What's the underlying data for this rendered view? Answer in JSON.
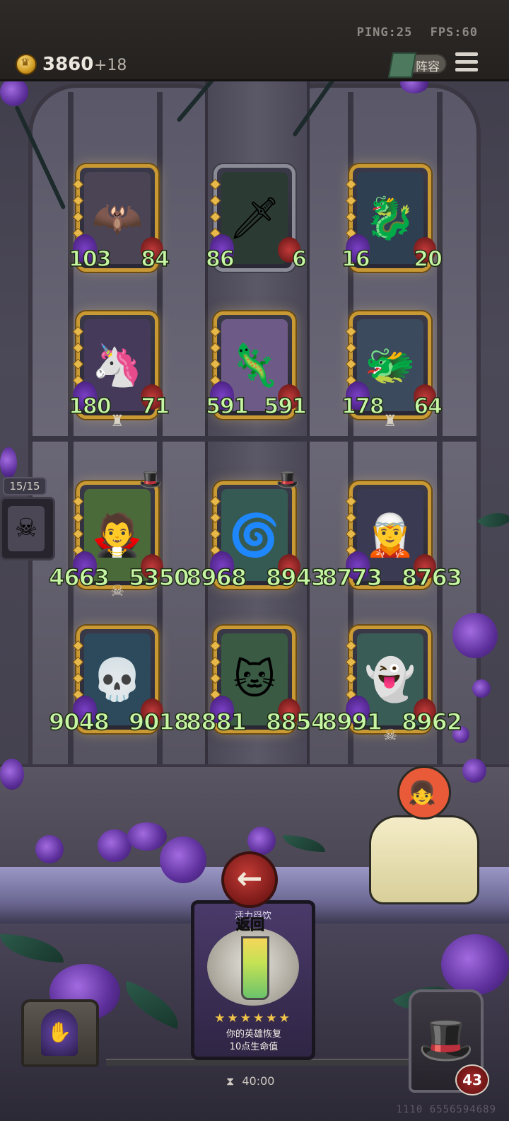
{
  "network": {
    "ping": "PING:25",
    "fps": "FPS:60"
  },
  "gold": {
    "amount": "3860",
    "delta": "+18"
  },
  "lineup_button": {
    "label": "阵容"
  },
  "bench": {
    "count": "15/15",
    "face": "☠"
  },
  "heroes": [
    {
      "atk": "103",
      "hp": "84",
      "art": "🦇",
      "bg": "#4a4454",
      "silver": false,
      "tribe": "",
      "hat": false
    },
    {
      "atk": "86",
      "hp": "6",
      "art": "🗡",
      "bg": "#2c3a34",
      "silver": true,
      "tribe": "",
      "hat": false
    },
    {
      "atk": "16",
      "hp": "20",
      "art": "🐉",
      "bg": "#2e3f52",
      "silver": false,
      "tribe": "",
      "hat": false
    },
    {
      "atk": "180",
      "hp": "71",
      "art": "🦄",
      "bg": "#463a5a",
      "silver": false,
      "tribe": "♜",
      "hat": false
    },
    {
      "atk": "591",
      "hp": "591",
      "art": "🦎",
      "bg": "#6e5a86",
      "silver": false,
      "tribe": "",
      "hat": false
    },
    {
      "atk": "178",
      "hp": "64",
      "art": "🐲",
      "bg": "#3b4a5c",
      "silver": false,
      "tribe": "♜",
      "hat": false
    },
    {
      "atk": "4663",
      "hp": "5350",
      "art": "🧛",
      "bg": "#4a6a3a",
      "silver": false,
      "tribe": "☠",
      "hat": true
    },
    {
      "atk": "8968",
      "hp": "8943",
      "art": "🌀",
      "bg": "#355a54",
      "silver": false,
      "tribe": "",
      "hat": true
    },
    {
      "atk": "8773",
      "hp": "8763",
      "art": "🧝",
      "bg": "#3a3a52",
      "silver": false,
      "tribe": "",
      "hat": false
    },
    {
      "atk": "9048",
      "hp": "9018",
      "art": "💀",
      "bg": "#2c4a5c",
      "silver": false,
      "tribe": "",
      "hat": false
    },
    {
      "atk": "8881",
      "hp": "8854",
      "art": "🐱",
      "bg": "#3a5a44",
      "silver": false,
      "tribe": "",
      "hat": false
    },
    {
      "atk": "8991",
      "hp": "8962",
      "art": "👻",
      "bg": "#3a5c56",
      "silver": false,
      "tribe": "☠",
      "hat": false
    }
  ],
  "back_button": {
    "icon": "←",
    "label": "返回"
  },
  "item_card": {
    "name": "活力舀饮",
    "stars": "★★★★★★",
    "desc_line1": "你的英雄恢复",
    "desc_line2": "10点生命值"
  },
  "timer": {
    "icon": "⧗",
    "value": "40:00"
  },
  "player": {
    "health": "43",
    "face": "🎩",
    "id": "1110 6556594689"
  },
  "chest": {
    "icon": "✋"
  },
  "shopkeeper": {
    "face": "👧"
  }
}
